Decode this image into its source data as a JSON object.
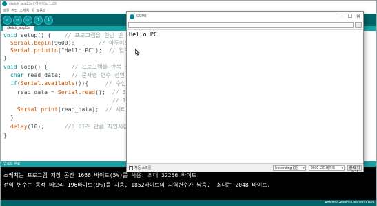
{
  "ide": {
    "window_title": "sketch_aug23a | 아두이노 1.8.5",
    "menu": [
      "파일",
      "편집",
      "스케치",
      "툴",
      "도움말"
    ],
    "toolbar": [
      {
        "name": "verify-icon",
        "glyph": "✓"
      },
      {
        "name": "upload-icon",
        "glyph": "→"
      },
      {
        "name": "new-icon",
        "glyph": "▫"
      },
      {
        "name": "open-icon",
        "glyph": "↑"
      },
      {
        "name": "save-icon",
        "glyph": "↓"
      }
    ],
    "serial_monitor_icon": "serial-monitor-icon",
    "tab_label": "sketch_aug23a",
    "code": [
      "void setup() {    // 프로그램을 한번 만 실",
      "  Serial.begin(9600);       // 아두이노",
      "  Serial.println(\"Hello PC\");  // 업로더와",
      "}",
      "void loop() {       // 프로그램을 반복 실",
      "  char read_data;   // 문자형 변수 선언",
      "  if(Serial.available()){     // 수신된",
      "    read_data = Serial.read();  // Serial",
      "                                // 1바이트",
      "    Serial.print(read_data);  // 시리얼 모",
      "  }",
      "  delay(10);      //0.01초 만큼 지연시킴",
      "}"
    ],
    "console_label": "업로드 완료",
    "console_lines": [
      "스케치는 프로그램 저장 공간 1666 바이트(5%)를 사용. 최대 32256 바이트.",
      "전역 변수는 동적 메모리 196바이트(9%)를 사용, 1852바이트의 지역변수가 남음.  최대는 2048 바이트."
    ],
    "board_status": "Arduino/Genuino Uno on COM8"
  },
  "serial_monitor": {
    "title": "COM8",
    "send_input_value": "",
    "send_label": "전송",
    "output": "Hello PC",
    "autoscroll_label": "자동 스크롤",
    "autoscroll_checked": true,
    "line_ending": "line ending 없음",
    "baud_rate": "9600 보드레이트",
    "clear_label": "출력 지우기"
  },
  "colors": {
    "toolbar": "#006468",
    "tabs": "#17a1a5",
    "keyword": "#00979c",
    "function": "#d35400",
    "comment": "#95a5a6",
    "console_bg": "#000000"
  }
}
